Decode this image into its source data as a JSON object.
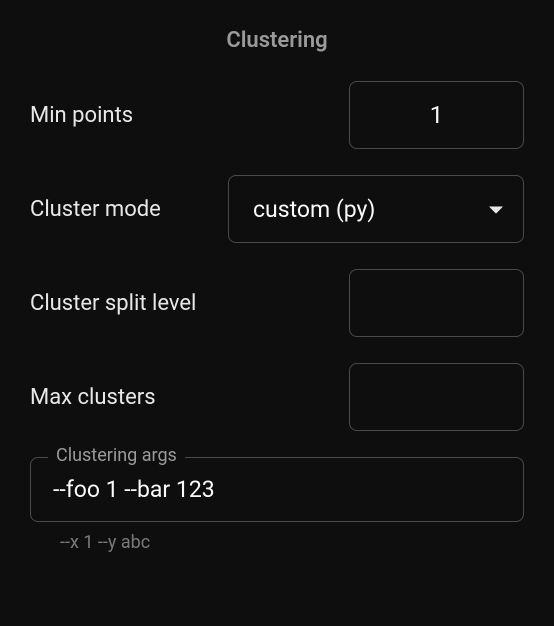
{
  "section_title": "Clustering",
  "fields": {
    "min_points": {
      "label": "Min points",
      "value": "1"
    },
    "cluster_mode": {
      "label": "Cluster mode",
      "value": "custom (py)"
    },
    "cluster_split_level": {
      "label": "Cluster split level",
      "value": ""
    },
    "max_clusters": {
      "label": "Max clusters",
      "value": ""
    },
    "clustering_args": {
      "legend": "Clustering args",
      "value": "--foo 1 --bar 123",
      "helper": "--x 1 --y abc"
    }
  }
}
